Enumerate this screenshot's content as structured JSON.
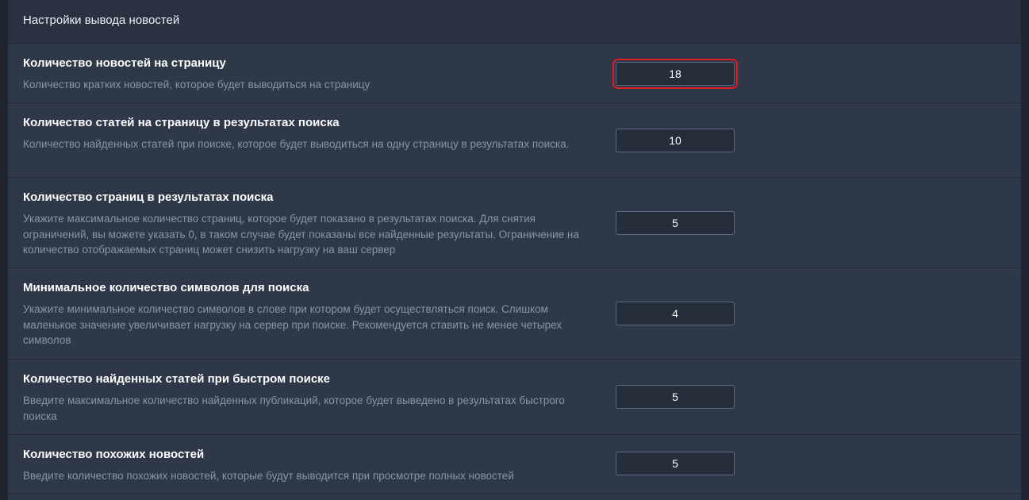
{
  "panel": {
    "title": "Настройки вывода новостей"
  },
  "settings": [
    {
      "title": "Количество новостей на страницу",
      "description": "Количество кратких новостей, которое будет выводиться на страницу",
      "value": "18"
    },
    {
      "title": "Количество статей на страницу в результатах поиска",
      "description": "Количество найденных статей при поиске, которое будет выводиться на одну страницу в результатах поиска.",
      "value": "10"
    },
    {
      "title": "Количество страниц в результатах поиска",
      "description": "Укажите максимальное количество страниц, которое будет показано в результатах поиска. Для снятия ограничений, вы можете указать 0, в таком случае будет показаны все найденные результаты. Ограничение на количество отображаемых страниц может снизить нагрузку на ваш сервер",
      "value": "5"
    },
    {
      "title": "Минимальное количество символов для поиска",
      "description": "Укажите минимальное количество символов в слове при котором будет осуществляться поиск. Слишком маленькое значение увеличивает нагрузку на сервер при поиске. Рекомендуется ставить не менее четырех символов",
      "value": "4"
    },
    {
      "title": "Количество найденных статей при быстром поиске",
      "description": "Введите максимальное количество найденных публикаций, которое будет выведено в результатах быстрого поиска",
      "value": "5"
    },
    {
      "title": "Количество похожих новостей",
      "description": "Введите количество похожих новостей, которые будут выводится при просмотре полных новостей",
      "value": "5"
    }
  ],
  "colors": {
    "panel_bg": "#2f3849",
    "header_bg": "#2a3140",
    "title_text": "#ffffff",
    "description_text": "#8994a6",
    "input_bg": "#252c3a",
    "input_border": "#5c6b84",
    "highlight": "#e01b24"
  }
}
